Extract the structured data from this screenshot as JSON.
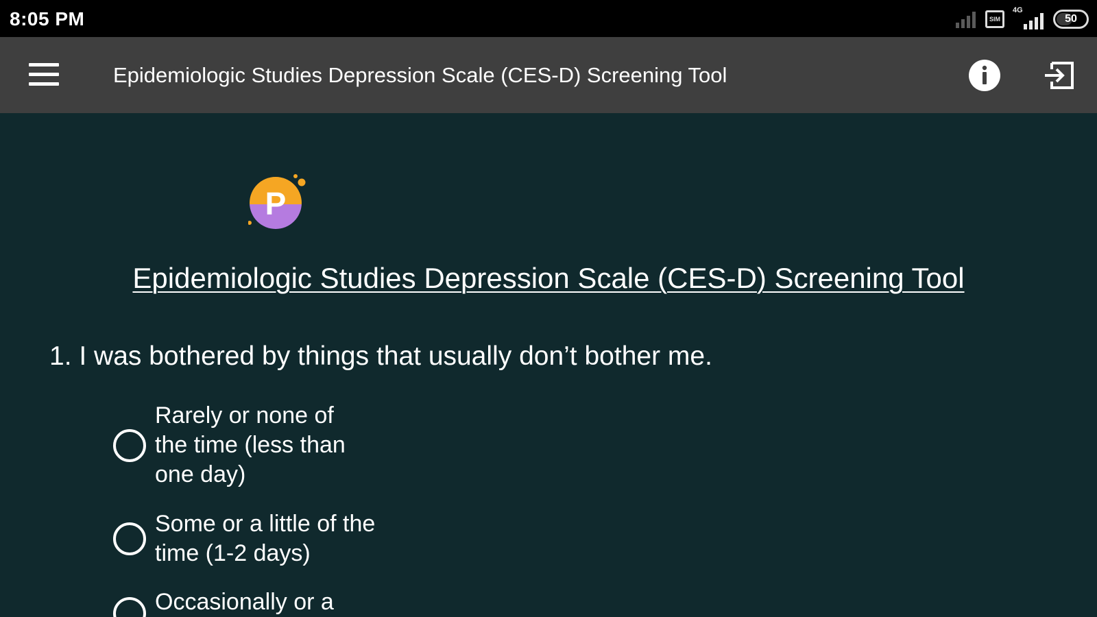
{
  "status_bar": {
    "time": "8:05 PM",
    "network_type": "4G",
    "battery_level": "50",
    "sim_label": "SIM"
  },
  "app_bar": {
    "title": "Epidemiologic Studies Depression Scale (CES-D) Screening Tool",
    "icons": [
      "menu-icon",
      "info-icon",
      "exit-icon"
    ]
  },
  "content": {
    "logo_letter": "P",
    "page_title": "Epidemiologic Studies Depression Scale (CES-D) Screening Tool",
    "question": "1. I was bothered by things that usually don’t bother me.",
    "options": [
      {
        "label": "Rarely or none of the time (less than one day)",
        "selected": false
      },
      {
        "label": "Some or a little of the time (1-2 days)",
        "selected": false
      },
      {
        "label": "Occasionally or a",
        "selected": false
      }
    ]
  },
  "colors": {
    "background": "#10292d",
    "app_bar": "#3f3f3f",
    "status_bar": "#000000",
    "logo_yellow": "#f5a623",
    "logo_purple": "#b57be0",
    "text": "#ffffff"
  }
}
